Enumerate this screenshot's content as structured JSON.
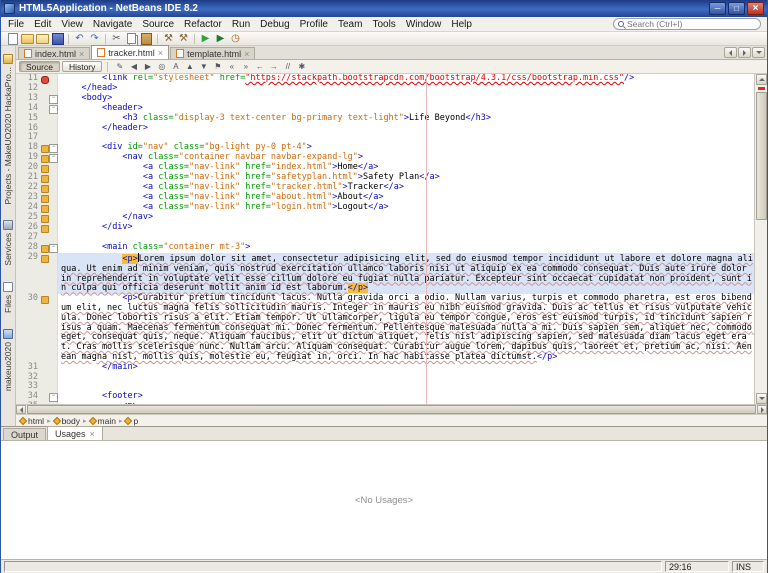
{
  "window": {
    "title": "HTML5Application - NetBeans IDE 8.2"
  },
  "menu": {
    "items": [
      "File",
      "Edit",
      "View",
      "Navigate",
      "Source",
      "Refactor",
      "Run",
      "Debug",
      "Profile",
      "Team",
      "Tools",
      "Window",
      "Help"
    ],
    "search_placeholder": "Search (Ctrl+I)"
  },
  "toolbar": {
    "icons": [
      {
        "name": "new-file-icon",
        "type": "i-page"
      },
      {
        "name": "new-project-icon",
        "type": "i-folder"
      },
      {
        "name": "open-project-icon",
        "type": "i-open"
      },
      {
        "name": "save-all-icon",
        "type": "i-save"
      },
      {
        "name": "sep",
        "type": "sep"
      },
      {
        "name": "undo-icon",
        "type": "c-undo",
        "glyph": "↶"
      },
      {
        "name": "redo-icon",
        "type": "c-undo",
        "glyph": "↷"
      },
      {
        "name": "sep",
        "type": "sep"
      },
      {
        "name": "cut-icon",
        "type": "c-cut",
        "glyph": "✂"
      },
      {
        "name": "copy-icon",
        "type": "i-copy"
      },
      {
        "name": "paste-icon",
        "type": "i-paste"
      },
      {
        "name": "sep",
        "type": "sep"
      },
      {
        "name": "build-project-icon",
        "type": "c-build",
        "glyph": "⚒"
      },
      {
        "name": "clean-build-icon",
        "type": "c-build",
        "glyph": "⚒"
      },
      {
        "name": "sep",
        "type": "sep"
      },
      {
        "name": "run-project-icon",
        "type": "c-run",
        "glyph": "▶"
      },
      {
        "name": "debug-project-icon",
        "type": "c-debug",
        "glyph": "▶"
      },
      {
        "name": "profile-project-icon",
        "type": "c-profile",
        "glyph": "◷"
      }
    ]
  },
  "left_strip": {
    "items": [
      {
        "name": "projects",
        "icon": "projects",
        "label": "Projects - MakeUO2020 HackaPro..."
      },
      {
        "name": "services",
        "icon": "services",
        "label": "Services"
      },
      {
        "name": "files",
        "icon": "files",
        "label": "Files"
      },
      {
        "name": "makeuo2020",
        "icon": "window",
        "label": "makeuo2020"
      }
    ]
  },
  "tabs": [
    {
      "label": "index.html",
      "active": false
    },
    {
      "label": "tracker.html",
      "active": true
    },
    {
      "label": "template.html",
      "active": false
    }
  ],
  "editor_toolbar": {
    "source_label": "Source",
    "history_label": "History",
    "icons": [
      {
        "name": "last-edit-icon",
        "glyph": "✎"
      },
      {
        "name": "back-icon",
        "glyph": "◀"
      },
      {
        "name": "forward-icon",
        "glyph": "▶"
      },
      {
        "name": "find-selection-icon",
        "glyph": "◎"
      },
      {
        "name": "highlight-occurrences-icon",
        "glyph": "A"
      },
      {
        "name": "previous-occurrence-icon",
        "glyph": "▲"
      },
      {
        "name": "next-occurrence-icon",
        "glyph": "▼"
      },
      {
        "name": "toggle-bookmark-icon",
        "glyph": "⚑"
      },
      {
        "name": "previous-bookmark-icon",
        "glyph": "«"
      },
      {
        "name": "next-bookmark-icon",
        "glyph": "»"
      },
      {
        "name": "shift-left-icon",
        "glyph": "←"
      },
      {
        "name": "shift-right-icon",
        "glyph": "→"
      },
      {
        "name": "comment-icon",
        "glyph": "//"
      },
      {
        "name": "uncomment-icon",
        "glyph": "✱"
      }
    ]
  },
  "editor": {
    "lines": [
      {
        "n": "11",
        "err": true,
        "tokens": [
          [
            "t",
            "        <link "
          ],
          [
            "a",
            "rel="
          ],
          [
            "v",
            "\"stylesheet\""
          ],
          [
            "a",
            " href="
          ],
          [
            "e",
            "\"https://stackpath.bootstrapcdn.com/bootstrap/4.3.1/css/bootstrap.min.css\""
          ],
          [
            "t",
            "/>"
          ]
        ]
      },
      {
        "n": "12",
        "tokens": [
          [
            "t",
            "    </head>"
          ]
        ]
      },
      {
        "n": "13",
        "fold": true,
        "tokens": [
          [
            "t",
            "    <body>"
          ]
        ]
      },
      {
        "n": "14",
        "fold": true,
        "tokens": [
          [
            "t",
            "        <header>"
          ]
        ]
      },
      {
        "n": "15",
        "tokens": [
          [
            "t",
            "            <h3 "
          ],
          [
            "a",
            "class="
          ],
          [
            "v",
            "\"display-3 text-center bg-primary text-light\""
          ],
          [
            "t",
            ">"
          ],
          [
            "p",
            "Life Beyond"
          ],
          [
            "t",
            "</h3>"
          ]
        ]
      },
      {
        "n": "16",
        "tokens": [
          [
            "t",
            "        </header>"
          ]
        ]
      },
      {
        "n": "17",
        "tokens": []
      },
      {
        "n": "18",
        "fold": true,
        "mark": true,
        "tokens": [
          [
            "t",
            "        <div "
          ],
          [
            "a",
            "id="
          ],
          [
            "v",
            "\"nav\""
          ],
          [
            "a",
            " class="
          ],
          [
            "v",
            "\"bg-light py-0 pt-4\""
          ],
          [
            "t",
            ">"
          ]
        ]
      },
      {
        "n": "19",
        "fold": true,
        "mark": true,
        "tokens": [
          [
            "t",
            "            <nav "
          ],
          [
            "a",
            "class="
          ],
          [
            "v",
            "\"container navbar navbar-expand-lg\""
          ],
          [
            "t",
            ">"
          ]
        ]
      },
      {
        "n": "20",
        "mark": true,
        "tokens": [
          [
            "t",
            "                <a "
          ],
          [
            "a",
            "class="
          ],
          [
            "v",
            "\"nav-link\""
          ],
          [
            "a",
            " href="
          ],
          [
            "v",
            "\"index.html\""
          ],
          [
            "t",
            ">"
          ],
          [
            "p",
            "Home"
          ],
          [
            "t",
            "</a>"
          ]
        ]
      },
      {
        "n": "21",
        "mark": true,
        "tokens": [
          [
            "t",
            "                <a "
          ],
          [
            "a",
            "class="
          ],
          [
            "v",
            "\"nav-link\""
          ],
          [
            "a",
            " href="
          ],
          [
            "v",
            "\"safetyplan.html\""
          ],
          [
            "t",
            ">"
          ],
          [
            "p",
            "Safety Plan"
          ],
          [
            "t",
            "</a>"
          ]
        ]
      },
      {
        "n": "22",
        "mark": true,
        "tokens": [
          [
            "t",
            "                <a "
          ],
          [
            "a",
            "class="
          ],
          [
            "v",
            "\"nav-link\""
          ],
          [
            "a",
            " href="
          ],
          [
            "v",
            "\"tracker.html\""
          ],
          [
            "t",
            ">"
          ],
          [
            "p",
            "Tracker"
          ],
          [
            "t",
            "</a>"
          ]
        ]
      },
      {
        "n": "23",
        "mark": true,
        "tokens": [
          [
            "t",
            "                <a "
          ],
          [
            "a",
            "class="
          ],
          [
            "v",
            "\"nav-link\""
          ],
          [
            "a",
            " href="
          ],
          [
            "v",
            "\"about.html\""
          ],
          [
            "t",
            ">"
          ],
          [
            "p",
            "About"
          ],
          [
            "t",
            "</a>"
          ]
        ]
      },
      {
        "n": "24",
        "mark": true,
        "tokens": [
          [
            "t",
            "                <a "
          ],
          [
            "a",
            "class="
          ],
          [
            "v",
            "\"nav-link\""
          ],
          [
            "a",
            " href="
          ],
          [
            "v",
            "\"login.html\""
          ],
          [
            "t",
            ">"
          ],
          [
            "p",
            "Logout"
          ],
          [
            "t",
            "</a>"
          ]
        ]
      },
      {
        "n": "25",
        "mark": true,
        "tokens": [
          [
            "t",
            "            </nav>"
          ]
        ]
      },
      {
        "n": "26",
        "mark": true,
        "tokens": [
          [
            "t",
            "        </div>"
          ]
        ]
      },
      {
        "n": "27",
        "tokens": []
      },
      {
        "n": "28",
        "fold": true,
        "mark": true,
        "tokens": [
          [
            "t",
            "        <main "
          ],
          [
            "a",
            "class="
          ],
          [
            "v",
            "\"container mt-3\""
          ],
          [
            "t",
            ">"
          ]
        ]
      },
      {
        "n": "29",
        "cur": true,
        "mark": true,
        "tokens": [
          [
            "p",
            "            "
          ],
          [
            "h",
            "<p>"
          ],
          [
            "caret",
            ""
          ],
          [
            "s",
            "Lorem ipsum dolor sit amet, consectetur adipisicing elit, sed do eiusmod tempor incididunt ut labore et dolore magna aliqua. Ut enim ad minim veniam, quis nostrud exercitation ullamco laboris nisi ut aliquip ex ea commodo consequat. Duis aute irure dolor in reprehenderit in voluptate velit esse cillum dolore eu fugiat nulla pariatur. Excepteur sint occaecat cupidatat non proident, sunt in culpa qui officia deserunt mollit anim id est laborum."
          ],
          [
            "h",
            "</p>"
          ]
        ]
      },
      {
        "n": "30",
        "mark": true,
        "tokens": [
          [
            "p",
            "            "
          ],
          [
            "t",
            "<p>"
          ],
          [
            "s",
            "Curabitur pretium tincidunt lacus. Nulla gravida orci a odio. Nullam varius, turpis et commodo pharetra, est eros bibendum elit, nec luctus magna felis sollicitudin mauris. Integer in mauris eu nibh euismod gravida. Duis ac tellus et risus vulputate vehicula. Donec lobortis risus a elit. Etiam tempor. Ut ullamcorper, ligula eu tempor congue, eros est euismod turpis, id tincidunt sapien risus a quam. Maecenas fermentum consequat mi. Donec fermentum. Pellentesque malesuada nulla a mi. Duis sapien sem, aliquet nec, commodo eget, consequat quis, neque. Aliquam faucibus, elit ut dictum aliquet, felis nisl adipiscing sapien, sed malesuada diam lacus eget erat. Cras mollis scelerisque nunc. Nullam arcu. Aliquam consequat. Curabitur augue lorem, dapibus quis, laoreet et, pretium ac, nisi. Aenean magna nisl, mollis quis, molestie eu, feugiat in, orci. In hac habitasse platea dictumst."
          ],
          [
            "t",
            "</p>"
          ]
        ]
      },
      {
        "n": "31",
        "tokens": [
          [
            "t",
            "        </main>"
          ]
        ]
      },
      {
        "n": "32",
        "tokens": []
      },
      {
        "n": "33",
        "tokens": []
      },
      {
        "n": "34",
        "fold": true,
        "tokens": [
          [
            "t",
            "        <footer>"
          ]
        ]
      },
      {
        "n": "35",
        "tokens": [
          [
            "p",
            "            "
          ],
          [
            "t",
            "<p>"
          ]
        ]
      }
    ]
  },
  "breadcrumb": [
    "html",
    "body",
    "main",
    "p"
  ],
  "output": {
    "tabs": [
      {
        "label": "Output",
        "active": false
      },
      {
        "label": "Usages",
        "active": true
      }
    ],
    "empty_text": "<No Usages>"
  },
  "status": {
    "caret": "29:16",
    "mode": "INS"
  }
}
